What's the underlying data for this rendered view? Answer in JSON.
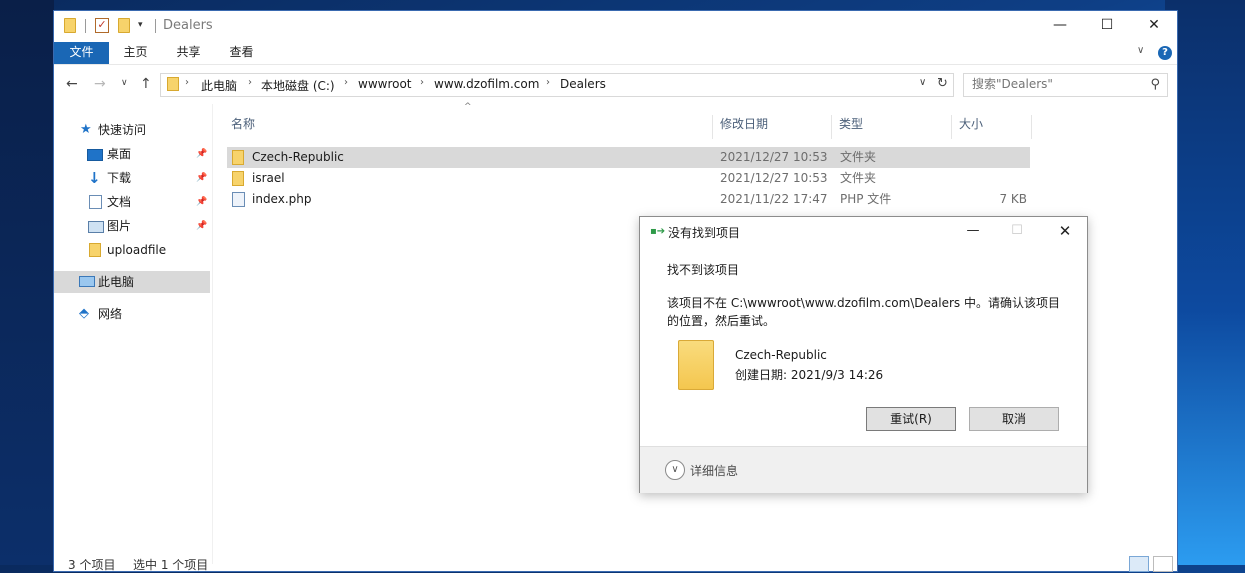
{
  "window": {
    "title": "Dealers",
    "minimize": "—",
    "maximize": "☐",
    "close": "✕"
  },
  "ribbon": {
    "tabs": [
      "文件",
      "主页",
      "共享",
      "查看"
    ],
    "chevron": "∨",
    "help": "?"
  },
  "nav": {
    "back": "←",
    "forward": "→",
    "recent": "∨",
    "up": "↑",
    "breadcrumb": [
      "此电脑",
      "本地磁盘 (C:)",
      "wwwroot",
      "www.dzofilm.com",
      "Dealers"
    ],
    "separator": "›",
    "dropdown": "∨",
    "refresh": "↻",
    "search_placeholder": "搜索\"Dealers\"",
    "search_icon": "⚲"
  },
  "sidebar": {
    "items": [
      {
        "label": "快速访问",
        "icon": "star-icon"
      },
      {
        "label": "桌面",
        "icon": "desktop-icon",
        "pinned": true
      },
      {
        "label": "下载",
        "icon": "download-icon",
        "pinned": true
      },
      {
        "label": "文档",
        "icon": "document-icon",
        "pinned": true
      },
      {
        "label": "图片",
        "icon": "pictures-icon",
        "pinned": true
      },
      {
        "label": "uploadfile",
        "icon": "folder-icon"
      },
      {
        "label": "此电脑",
        "icon": "computer-icon",
        "selected": true
      },
      {
        "label": "网络",
        "icon": "network-icon"
      }
    ],
    "pin_glyph": "📌"
  },
  "filelist": {
    "columns": [
      "名称",
      "修改日期",
      "类型",
      "大小"
    ],
    "sort_caret": "^",
    "rows": [
      {
        "name": "Czech-Republic",
        "date": "2021/12/27 10:53",
        "type": "文件夹",
        "size": "",
        "kind": "folder",
        "selected": true
      },
      {
        "name": "israel",
        "date": "2021/12/27 10:53",
        "type": "文件夹",
        "size": "",
        "kind": "folder"
      },
      {
        "name": "index.php",
        "date": "2021/11/22 17:47",
        "type": "PHP 文件",
        "size": "7 KB",
        "kind": "php"
      }
    ]
  },
  "status": {
    "count": "3 个项目",
    "selection": "选中 1 个项目"
  },
  "dialog": {
    "title": "没有找到项目",
    "heading": "找不到该项目",
    "message_line1": "该项目不在 C:\\wwwroot\\www.dzofilm.com\\Dealers 中。请确认该项目",
    "message_line2": "的位置，然后重试。",
    "item_name": "Czech-Republic",
    "item_created": "创建日期: 2021/9/3 14:26",
    "retry_label": "重试(R)",
    "cancel_label": "取消",
    "details_label": "详细信息",
    "details_chevron": "∨",
    "minimize": "—",
    "maximize": "☐",
    "close": "✕"
  },
  "colors": {
    "accent": "#1a67b5",
    "selection": "#d9d9d9",
    "folder": "#f7d36b"
  }
}
